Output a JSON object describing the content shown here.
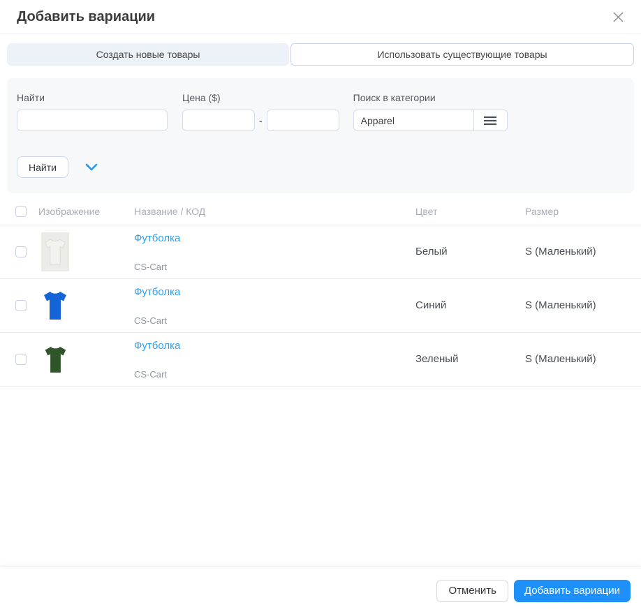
{
  "modal": {
    "title": "Добавить вариации"
  },
  "tabs": [
    {
      "label": "Создать новые товары",
      "active": false
    },
    {
      "label": "Использовать существующие товары",
      "active": true
    }
  ],
  "filters": {
    "search": {
      "label": "Найти",
      "value": ""
    },
    "price": {
      "label": "Цена ($)",
      "from_value": "",
      "to_value": "",
      "separator": "-"
    },
    "category": {
      "label": "Поиск в категории",
      "value": "Apparel"
    },
    "search_button_label": "Найти"
  },
  "table": {
    "columns": {
      "image": "Изображение",
      "name_code": "Название / КОД",
      "color": "Цвет",
      "size": "Размер"
    },
    "rows": [
      {
        "name": "Футболка",
        "code": "CS-Cart",
        "color": "Белый",
        "size": "S (Маленький)",
        "checked": false,
        "shirt_hex": "#f3f3ee",
        "photo_bg": "#ebebe7"
      },
      {
        "name": "Футболка",
        "code": "CS-Cart",
        "color": "Синий",
        "size": "S (Маленький)",
        "checked": false,
        "shirt_hex": "#1464d8"
      },
      {
        "name": "Футболка",
        "code": "CS-Cart",
        "color": "Зеленый",
        "size": "S (Маленький)",
        "checked": false,
        "shirt_hex": "#30552a"
      }
    ]
  },
  "footer": {
    "cancel_label": "Отменить",
    "submit_label": "Добавить вариации"
  },
  "colors": {
    "accent_blue": "#2196f3",
    "link_blue": "#2da0f2",
    "primary_button_blue": "#1e90fa",
    "inactive_tab_bg": "#edf1f8",
    "filter_panel_bg": "#f7f8f9"
  }
}
